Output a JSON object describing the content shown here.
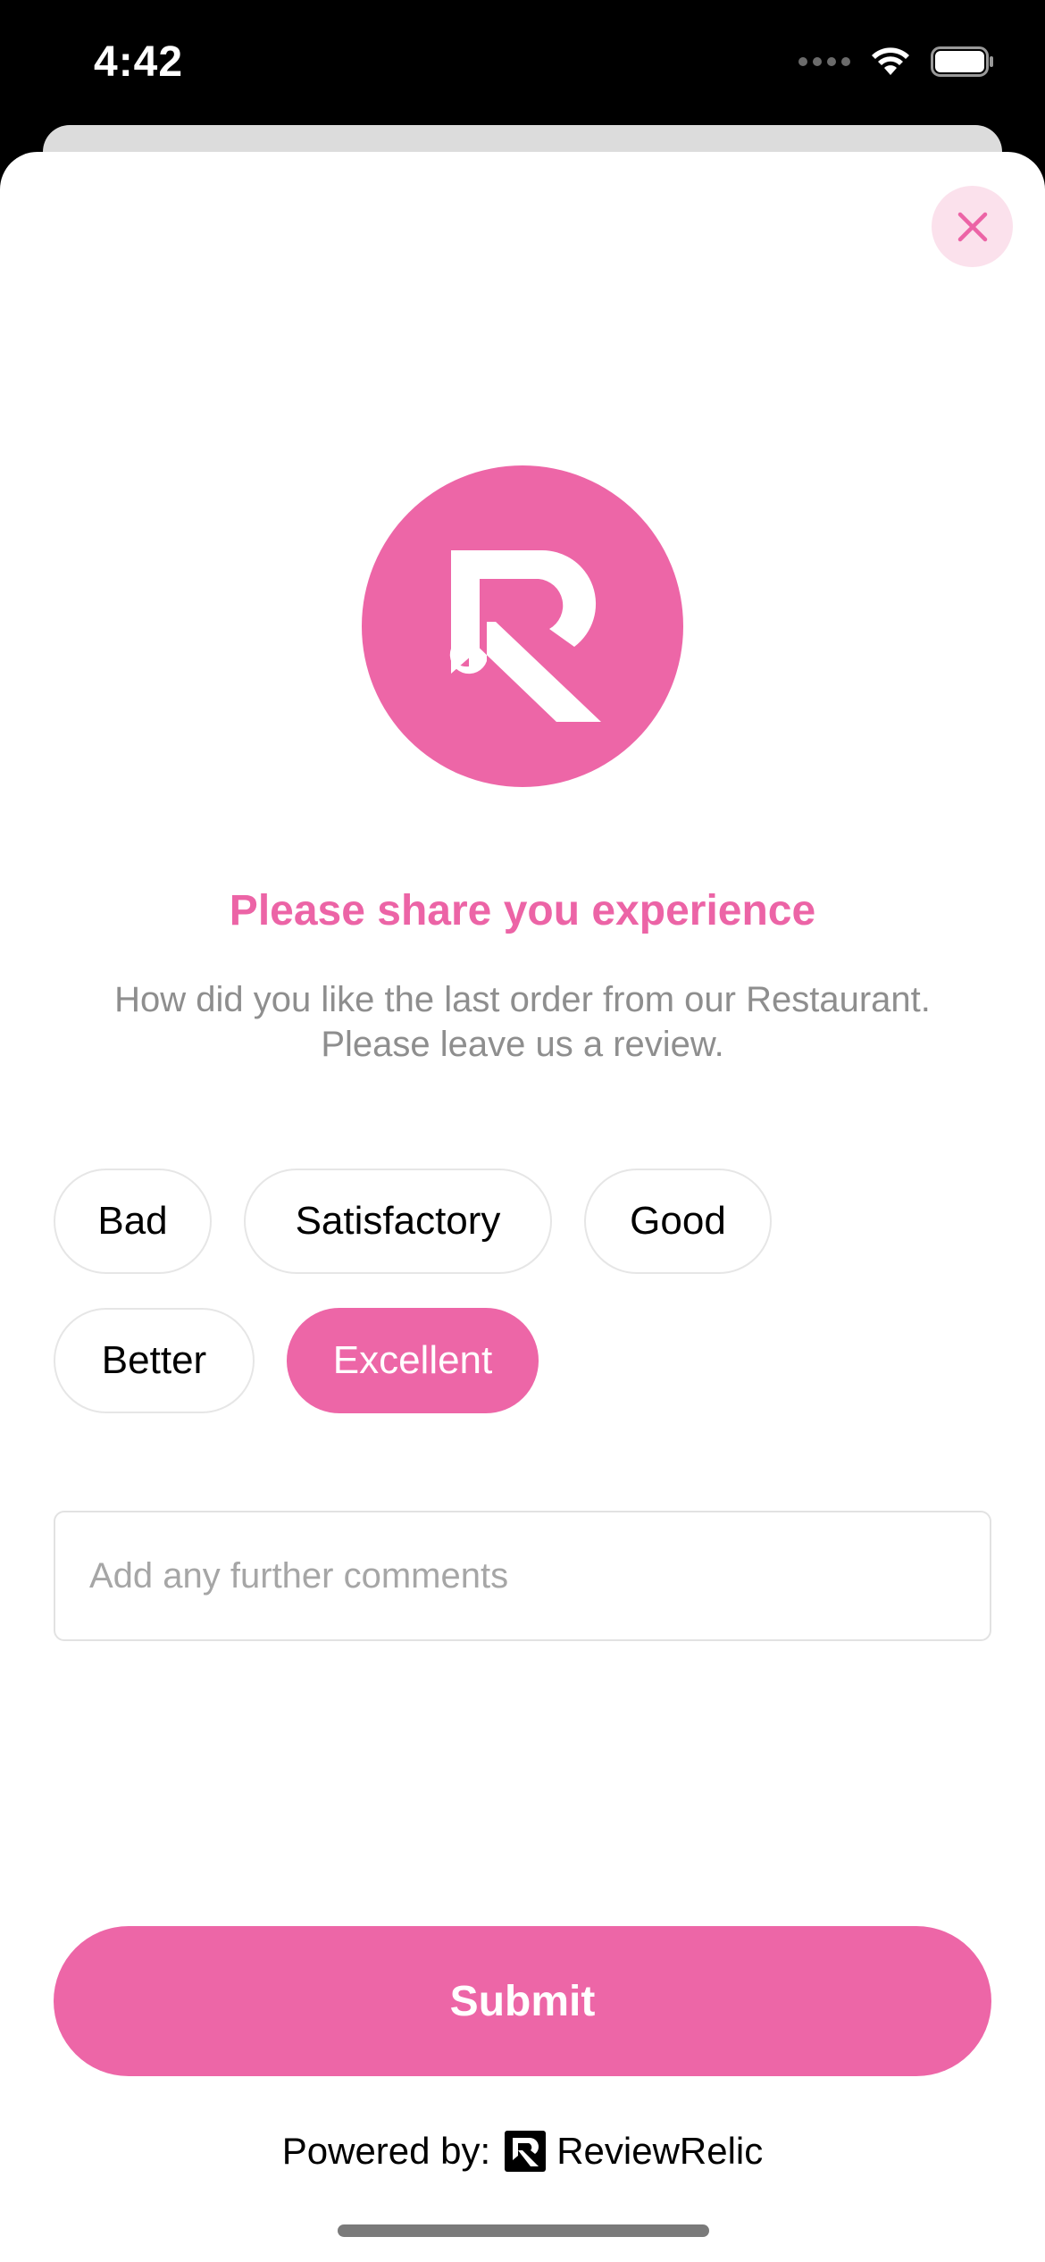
{
  "status_bar": {
    "time": "4:42",
    "icons": [
      "signal-dots-icon",
      "wifi-icon",
      "battery-icon"
    ]
  },
  "close_button": {
    "icon": "close-icon"
  },
  "logo": {
    "icon": "reviewrelic-logo-icon"
  },
  "heading": "Please share you experience",
  "subtext": {
    "line1": "How did you like the last order from our Restaurant.",
    "line2": "Please leave us a review."
  },
  "ratings": [
    {
      "label": "Bad",
      "selected": false
    },
    {
      "label": "Satisfactory",
      "selected": false
    },
    {
      "label": "Good",
      "selected": false
    },
    {
      "label": "Better",
      "selected": false
    },
    {
      "label": "Excellent",
      "selected": true
    }
  ],
  "comments": {
    "placeholder": "Add any further comments",
    "value": ""
  },
  "submit_label": "Submit",
  "footer": {
    "powered_by": "Powered by:",
    "brand": "ReviewRelic"
  },
  "colors": {
    "accent": "#ED66A7",
    "close_bg": "#FBE1EC",
    "subtext": "#8E8E8E",
    "placeholder": "#A6A6A6"
  }
}
